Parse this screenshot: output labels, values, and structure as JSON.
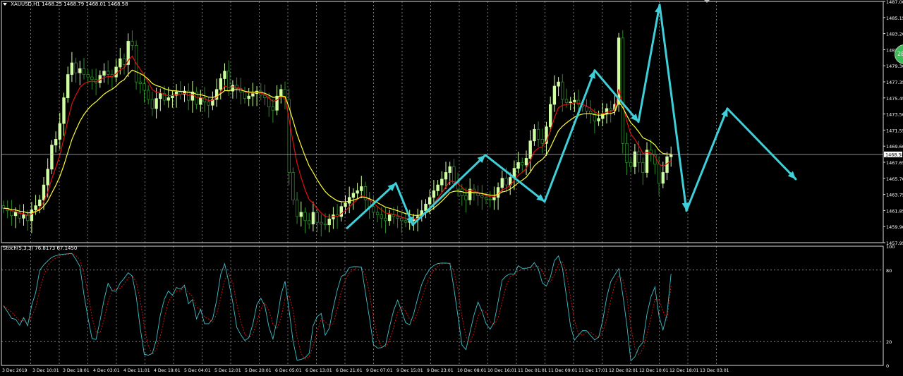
{
  "header": {
    "symbol": "XAUUSD,H1",
    "ohlc": "1468.25 1468.79 1468.01 1468.58"
  },
  "indicator": {
    "name": "Stoch(5,3,3)",
    "values": "76.8173 67.1450"
  },
  "badge": {
    "text": "28"
  },
  "price_axis": {
    "labels": [
      "1487.00",
      "1485.15",
      "1483.20",
      "1481.25",
      "1479.30",
      "1477.35",
      "1475.45",
      "1473.50",
      "1471.55",
      "1469.60",
      "1467.65",
      "1465.70",
      "1463.75",
      "1461.85",
      "1459.90",
      "1457.95"
    ],
    "current_price": "1468.58"
  },
  "stoch_axis": {
    "labels": [
      "100",
      "80",
      "20",
      "0"
    ]
  },
  "time_axis": {
    "labels": [
      "3 Dec 2019",
      "3 Dec 10:01",
      "3 Dec 18:01",
      "4 Dec 03:01",
      "4 Dec 11:01",
      "4 Dec 19:01",
      "5 Dec 04:01",
      "5 Dec 12:01",
      "5 Dec 20:01",
      "6 Dec 05:01",
      "6 Dec 13:01",
      "6 Dec 21:01",
      "9 Dec 07:01",
      "9 Dec 15:01",
      "9 Dec 23:01",
      "10 Dec 08:01",
      "10 Dec 16:01",
      "11 Dec 01:01",
      "11 Dec 09:01",
      "11 Dec 17:01",
      "12 Dec 02:01",
      "12 Dec 10:01",
      "12 Dec 18:01",
      "13 Dec 03:01"
    ]
  },
  "colors": {
    "background": "#000000",
    "bull_candle": "#cfffa0",
    "bear_candle": "#2a8a2a",
    "fast_ma": "#e01010",
    "slow_ma": "#ffff33",
    "zigzag": "#3fcfd8",
    "stoch_main": "#3fc0c8",
    "stoch_signal": "#e01010",
    "grid": "#c8c8c8"
  },
  "chart_data": {
    "type": "candlestick",
    "symbol": "XAUUSD",
    "timeframe": "H1",
    "ylim": [
      1457.95,
      1487.0
    ],
    "close_series": [
      1462.1,
      1461.8,
      1461.2,
      1461.6,
      1460.9,
      1461.3,
      1460.6,
      1461.9,
      1462.4,
      1463.1,
      1464.9,
      1466.8,
      1469.7,
      1470.4,
      1472.3,
      1475.4,
      1478.2,
      1479.6,
      1478.4,
      1478.9,
      1478.2,
      1477.9,
      1477.6,
      1477.2,
      1478.1,
      1478.6,
      1478.2,
      1477.9,
      1479.1,
      1480.1,
      1479.4,
      1482.2,
      1481.7,
      1477.3,
      1477.1,
      1476.3,
      1475.2,
      1474.1,
      1475.3,
      1475.9,
      1475.1,
      1475.4,
      1475.7,
      1476.1,
      1475.8,
      1476.2,
      1475.1,
      1476.1,
      1474.6,
      1475.4,
      1474.9,
      1474.5,
      1475.2,
      1476.4,
      1477.7,
      1478.6,
      1476.2,
      1476.9,
      1476.5,
      1476.1,
      1475.3,
      1475.6,
      1475.9,
      1476.2,
      1475.7,
      1475.4,
      1474.3,
      1473.9,
      1475.6,
      1476.4,
      1475.2,
      1466.4,
      1463.1,
      1461.1,
      1461.6,
      1460.6,
      1460.2,
      1461.6,
      1460.4,
      1460.2,
      1460.1,
      1460.8,
      1461.3,
      1461.1,
      1462.3,
      1462.7,
      1463.4,
      1463.9,
      1464.2,
      1464.7,
      1463.1,
      1462.3,
      1461.6,
      1461.3,
      1460.9,
      1460.6,
      1461.3,
      1461.1,
      1460.9,
      1460.6,
      1460.4,
      1460.6,
      1460.8,
      1461.1,
      1461.8,
      1462.6,
      1463.4,
      1464.2,
      1464.9,
      1465.6,
      1466.4,
      1467.1,
      1465.1,
      1464.4,
      1463.6,
      1463.1,
      1464.4,
      1463.9,
      1463.6,
      1463.4,
      1463.2,
      1463.1,
      1463.4,
      1464.6,
      1465.7,
      1464.9,
      1465.8,
      1466.9,
      1467.6,
      1467.3,
      1468.1,
      1470.2,
      1471.6,
      1470.4,
      1469.9,
      1471.9,
      1474.6,
      1476.8,
      1477.3,
      1475.2,
      1474.8,
      1474.9,
      1475.1,
      1474.6,
      1474.3,
      1473.8,
      1473.5,
      1472.6,
      1472.9,
      1473.5,
      1474.1,
      1473.9,
      1474.6,
      1482.6,
      1469.9,
      1467.6,
      1467.1,
      1468.9,
      1467.6,
      1466.4,
      1469.1,
      1468.6,
      1467.4,
      1465.1,
      1466.4,
      1468.3,
      1468.58
    ],
    "fast_ma_label": "",
    "slow_ma_label": "",
    "zigzag_points": [
      {
        "time": "6 Dec 21:01",
        "price": 1459.7
      },
      {
        "time": "9 Dec 07:01",
        "price": 1465.1
      },
      {
        "time": "9 Dec 15:01",
        "price": 1460.1
      },
      {
        "time": "10 Dec 08:01",
        "price": 1468.5
      },
      {
        "time": "11 Dec 01:01",
        "price": 1462.9
      },
      {
        "time": "11 Dec 17:01",
        "price": 1478.7
      },
      {
        "time": "12 Dec 02:01",
        "price": 1472.5
      },
      {
        "time": "12 Dec 10:01",
        "price": 1486.6
      },
      {
        "time": "12 Dec 18:01",
        "price": 1461.8
      },
      {
        "time": "13 Dec 03:01",
        "price": 1474.1
      },
      {
        "time": "13 Dec 15:01",
        "price": 1465.6
      }
    ],
    "stochastic": {
      "levels": [
        80,
        20
      ],
      "ylim": [
        0,
        100
      ],
      "main_last": 76.8173,
      "signal_last": 67.145
    }
  }
}
